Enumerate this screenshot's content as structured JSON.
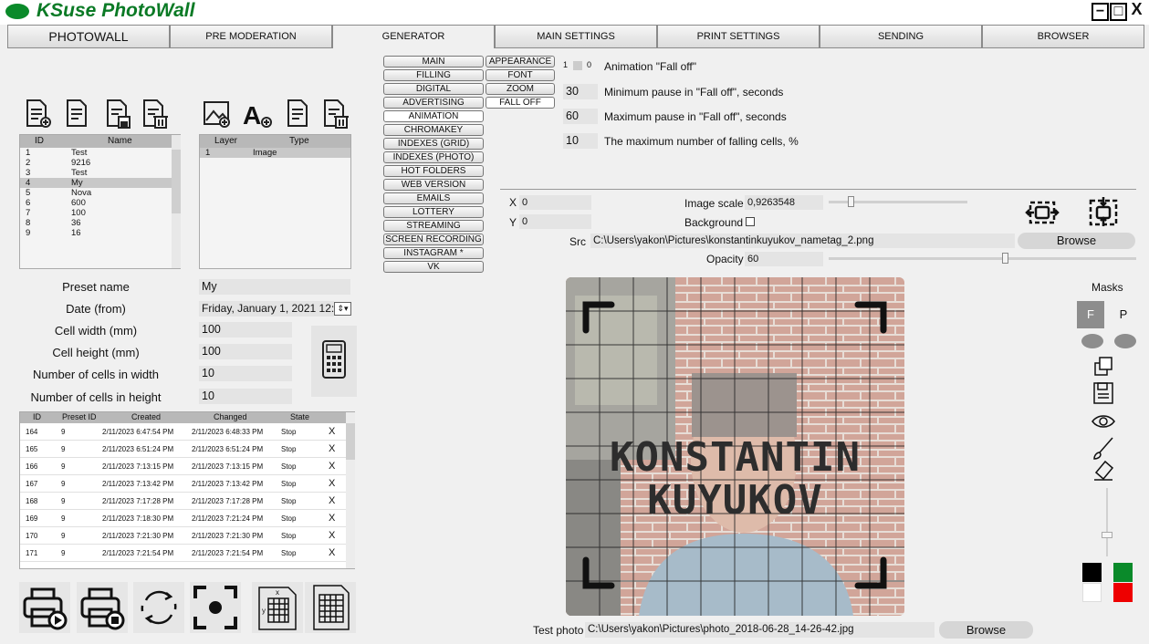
{
  "app": {
    "title": "KSuse PhotoWall",
    "win_buttons": [
      "−",
      "□",
      "X"
    ]
  },
  "tabs": [
    "PHOTOWALL",
    "PRE MODERATION",
    "GENERATOR",
    "MAIN SETTINGS",
    "PRINT SETTINGS",
    "SENDING",
    "BROWSER"
  ],
  "active_tab": "GENERATOR",
  "generator_menu": [
    "MAIN",
    "FILLING",
    "DIGITAL",
    "ADVERTISING",
    "ANIMATION",
    "CHROMAKEY",
    "INDEXES (GRID)",
    "INDEXES (PHOTO)",
    "HOT FOLDERS",
    "WEB VERSION",
    "EMAILS",
    "LOTTERY",
    "STREAMING",
    "SCREEN RECORDING",
    "INSTAGRAM *",
    "VK"
  ],
  "animation_menu": [
    "APPEARANCE",
    "FONT",
    "ZOOM",
    "FALL OFF"
  ],
  "fall_off": {
    "toggle_off": "1",
    "toggle_on": "0",
    "animation_label": "Animation \"Fall off\"",
    "min_pause": "30",
    "min_pause_label": "Minimum pause in \"Fall off\", seconds",
    "max_pause": "60",
    "max_pause_label": "Maximum pause in \"Fall off\", seconds",
    "max_cells": "10",
    "max_cells_label": "The maximum number of falling cells, %"
  },
  "presets": {
    "headers": [
      "ID",
      "Name"
    ],
    "rows": [
      [
        "1",
        "Test"
      ],
      [
        "2",
        "9216"
      ],
      [
        "3",
        "Test"
      ],
      [
        "4",
        "My"
      ],
      [
        "5",
        "Nova"
      ],
      [
        "6",
        "600"
      ],
      [
        "7",
        "100"
      ],
      [
        "8",
        "36"
      ],
      [
        "9",
        "16"
      ]
    ]
  },
  "layers": {
    "headers": [
      "Layer",
      "Type"
    ],
    "rows": [
      [
        "1",
        "Image"
      ]
    ]
  },
  "form": {
    "preset_name_label": "Preset name",
    "preset_name": "My",
    "date_label": "Date (from)",
    "date": "Friday, January 1, 2021 12:",
    "cell_width_label": "Cell width (mm)",
    "cell_width": "100",
    "cell_height_label": "Cell height (mm)",
    "cell_height": "100",
    "cells_w_label": "Number of cells in width",
    "cells_w": "10",
    "cells_h_label": "Number of cells in height",
    "cells_h": "10"
  },
  "history": {
    "headers": [
      "ID",
      "Preset ID",
      "Created",
      "Changed",
      "State"
    ],
    "rows": [
      [
        "164",
        "9",
        "2/11/2023 6:47:54 PM",
        "2/11/2023 6:48:33 PM",
        "Stop",
        "X"
      ],
      [
        "165",
        "9",
        "2/11/2023 6:51:24 PM",
        "2/11/2023 6:51:24 PM",
        "Stop",
        "X"
      ],
      [
        "166",
        "9",
        "2/11/2023 7:13:15 PM",
        "2/11/2023 7:13:15 PM",
        "Stop",
        "X"
      ],
      [
        "167",
        "9",
        "2/11/2023 7:13:42 PM",
        "2/11/2023 7:13:42 PM",
        "Stop",
        "X"
      ],
      [
        "168",
        "9",
        "2/11/2023 7:17:28 PM",
        "2/11/2023 7:17:28 PM",
        "Stop",
        "X"
      ],
      [
        "169",
        "9",
        "2/11/2023 7:18:30 PM",
        "2/11/2023 7:21:24 PM",
        "Stop",
        "X"
      ],
      [
        "170",
        "9",
        "2/11/2023 7:21:30 PM",
        "2/11/2023 7:21:30 PM",
        "Stop",
        "X"
      ],
      [
        "171",
        "9",
        "2/11/2023 7:21:54 PM",
        "2/11/2023 7:21:54 PM",
        "Stop",
        "X"
      ]
    ]
  },
  "layer_props": {
    "x_label": "X",
    "x": "0",
    "y_label": "Y",
    "y": "0",
    "scale_label": "Image scale",
    "scale": "0,9263548",
    "background_label": "Background",
    "src_label": "Src",
    "src": "C:\\Users\\yakon\\Pictures\\konstantinkuyukov_nametag_2.png",
    "opacity_label": "Opacity",
    "opacity": "60",
    "browse": "Browse"
  },
  "preview": {
    "name_line1": "KONSTANTIN",
    "name_line2": "KUYUKOV"
  },
  "masks": {
    "label": "Masks",
    "f": "F",
    "p": "P"
  },
  "test_photo": {
    "label": "Test photo",
    "path": "C:\\Users\\yakon\\Pictures\\photo_2018-06-28_14-26-42.jpg",
    "browse": "Browse"
  },
  "colors": {
    "accent": "#0a7a25",
    "black": "#000000",
    "green": "#0a8a2a",
    "white": "#ffffff",
    "red": "#ee0000"
  }
}
